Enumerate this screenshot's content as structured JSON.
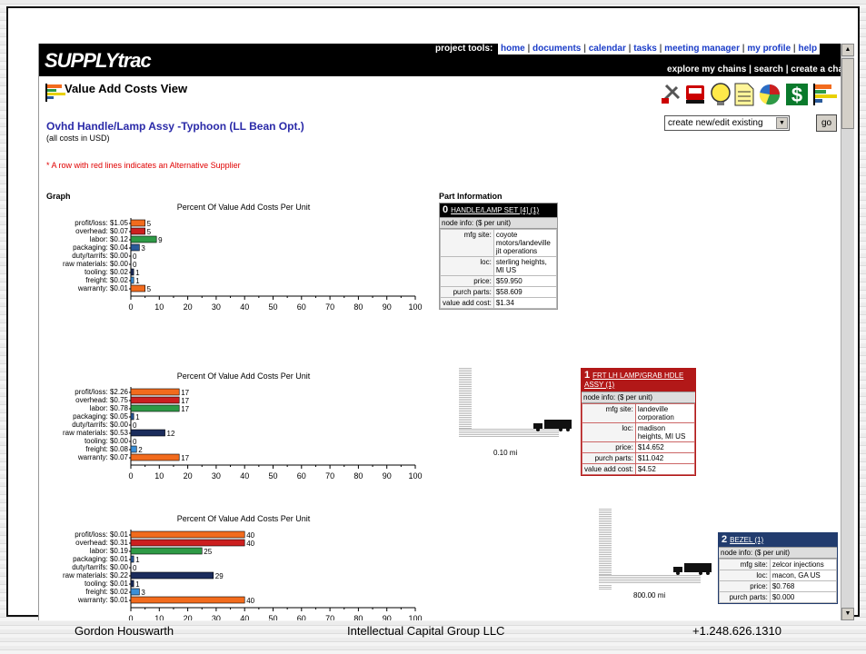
{
  "app": {
    "logo": "SUPPLYtrac",
    "project_tools_label": "project tools:",
    "nav_links": [
      "home",
      "documents",
      "calendar",
      "tasks",
      "meeting manager",
      "my profile",
      "help"
    ],
    "chain_links": [
      "explore my chains",
      "search",
      "create a chain"
    ],
    "view_title": "Value Add Costs View",
    "tool_icons": [
      "tools-icon",
      "truck-icon",
      "lightbulb-icon",
      "document-icon",
      "pie-chart-icon",
      "dollar-icon",
      "value-add-icon"
    ]
  },
  "chain": {
    "title": "Ovhd Handle/Lamp Assy -Typhoon (LL Bean Opt.)",
    "currency_note": "(all costs in USD)",
    "alt_supplier_note": "* A row with red lines indicates an Alternative Supplier",
    "select_value": "create new/edit existing",
    "go_label": "go"
  },
  "graph_label": "Graph",
  "part_info_label": "Part Information",
  "colors": {
    "profit": "#f26b1d",
    "overhead": "#cc1f1f",
    "labor": "#2e9a46",
    "packaging": "#2a5a9a",
    "duty": "#1a1a5a",
    "raw": "#1b2c5c",
    "tooling": "#1b2c5c",
    "freight": "#3b8fd6",
    "warranty": "#f26b1d"
  },
  "chart_data": [
    {
      "type": "bar",
      "title": "Percent Of Value Add Costs Per Unit",
      "categories": [
        "profit/loss: $1.05",
        "overhead: $0.07",
        "labor: $0.12",
        "packaging: $0.04",
        "duty/tarrifs: $0.00",
        "raw materials: $0.00",
        "tooling: $0.02",
        "freight: $0.02",
        "warranty: $0.01"
      ],
      "values": [
        5,
        5,
        9,
        3,
        0,
        0,
        1,
        1,
        5
      ],
      "xlim": [
        0,
        100
      ],
      "xticks": [
        0,
        10,
        20,
        30,
        40,
        50,
        60,
        70,
        80,
        90,
        100
      ]
    },
    {
      "type": "bar",
      "title": "Percent Of Value Add Costs Per Unit",
      "categories": [
        "profit/loss: $2.26",
        "overhead: $0.75",
        "labor: $0.78",
        "packaging: $0.05",
        "duty/tarrifs: $0.00",
        "raw materials: $0.53",
        "tooling: $0.00",
        "freight: $0.08",
        "warranty: $0.07"
      ],
      "values": [
        17,
        17,
        17,
        1,
        0,
        12,
        0,
        2,
        17
      ],
      "xlim": [
        0,
        100
      ],
      "xticks": [
        0,
        10,
        20,
        30,
        40,
        50,
        60,
        70,
        80,
        90,
        100
      ]
    },
    {
      "type": "bar",
      "title": "Percent Of Value Add Costs Per Unit",
      "categories": [
        "profit/loss: $0.01",
        "overhead: $0.31",
        "labor: $0.19",
        "packaging: $0.01",
        "duty/tarrifs: $0.00",
        "raw materials: $0.22",
        "tooling: $0.01",
        "freight: $0.02",
        "warranty: $0.01"
      ],
      "values": [
        40,
        40,
        25,
        1,
        0,
        29,
        1,
        3,
        40
      ],
      "xlim": [
        0,
        100
      ],
      "xticks": [
        0,
        10,
        20,
        30,
        40,
        50,
        60,
        70,
        80,
        90,
        100
      ]
    }
  ],
  "nodes": [
    {
      "num": "0",
      "name": "HANDLE/LAMP SET [4] (1)",
      "info": "node info: ($ per unit)",
      "rows": [
        {
          "k": "mfg site:",
          "v": "coyote motors/landeville jit operations"
        },
        {
          "k": "loc:",
          "v": "sterling heights, MI US"
        },
        {
          "k": "price:",
          "v": "$59.950"
        },
        {
          "k": "purch parts:",
          "v": "$58.609"
        },
        {
          "k": "value add cost:",
          "v": "$1.34"
        }
      ]
    },
    {
      "num": "1",
      "name": "FRT LH LAMP/GRAB HDLE ASSY (1)",
      "info": "node info: ($ per unit)",
      "rows": [
        {
          "k": "mfg site:",
          "v": "landeville corporation"
        },
        {
          "k": "loc:",
          "v": "madison heights, MI US"
        },
        {
          "k": "price:",
          "v": "$14.652"
        },
        {
          "k": "purch parts:",
          "v": "$11.042"
        },
        {
          "k": "value add cost:",
          "v": "$4.52"
        }
      ]
    },
    {
      "num": "2",
      "name": "BEZEL (1)",
      "info": "node info: ($ per unit)",
      "rows": [
        {
          "k": "mfg site:",
          "v": "zelcor injections"
        },
        {
          "k": "loc:",
          "v": "macon, GA US"
        },
        {
          "k": "price:",
          "v": "$0.768"
        },
        {
          "k": "purch parts:",
          "v": "$0.000"
        }
      ]
    }
  ],
  "distances": [
    "0.10 mi",
    "800.00 mi"
  ],
  "footer": {
    "name": "Gordon Houswarth",
    "company": "Intellectual Capital Group LLC",
    "phone": "+1.248.626.1310"
  }
}
